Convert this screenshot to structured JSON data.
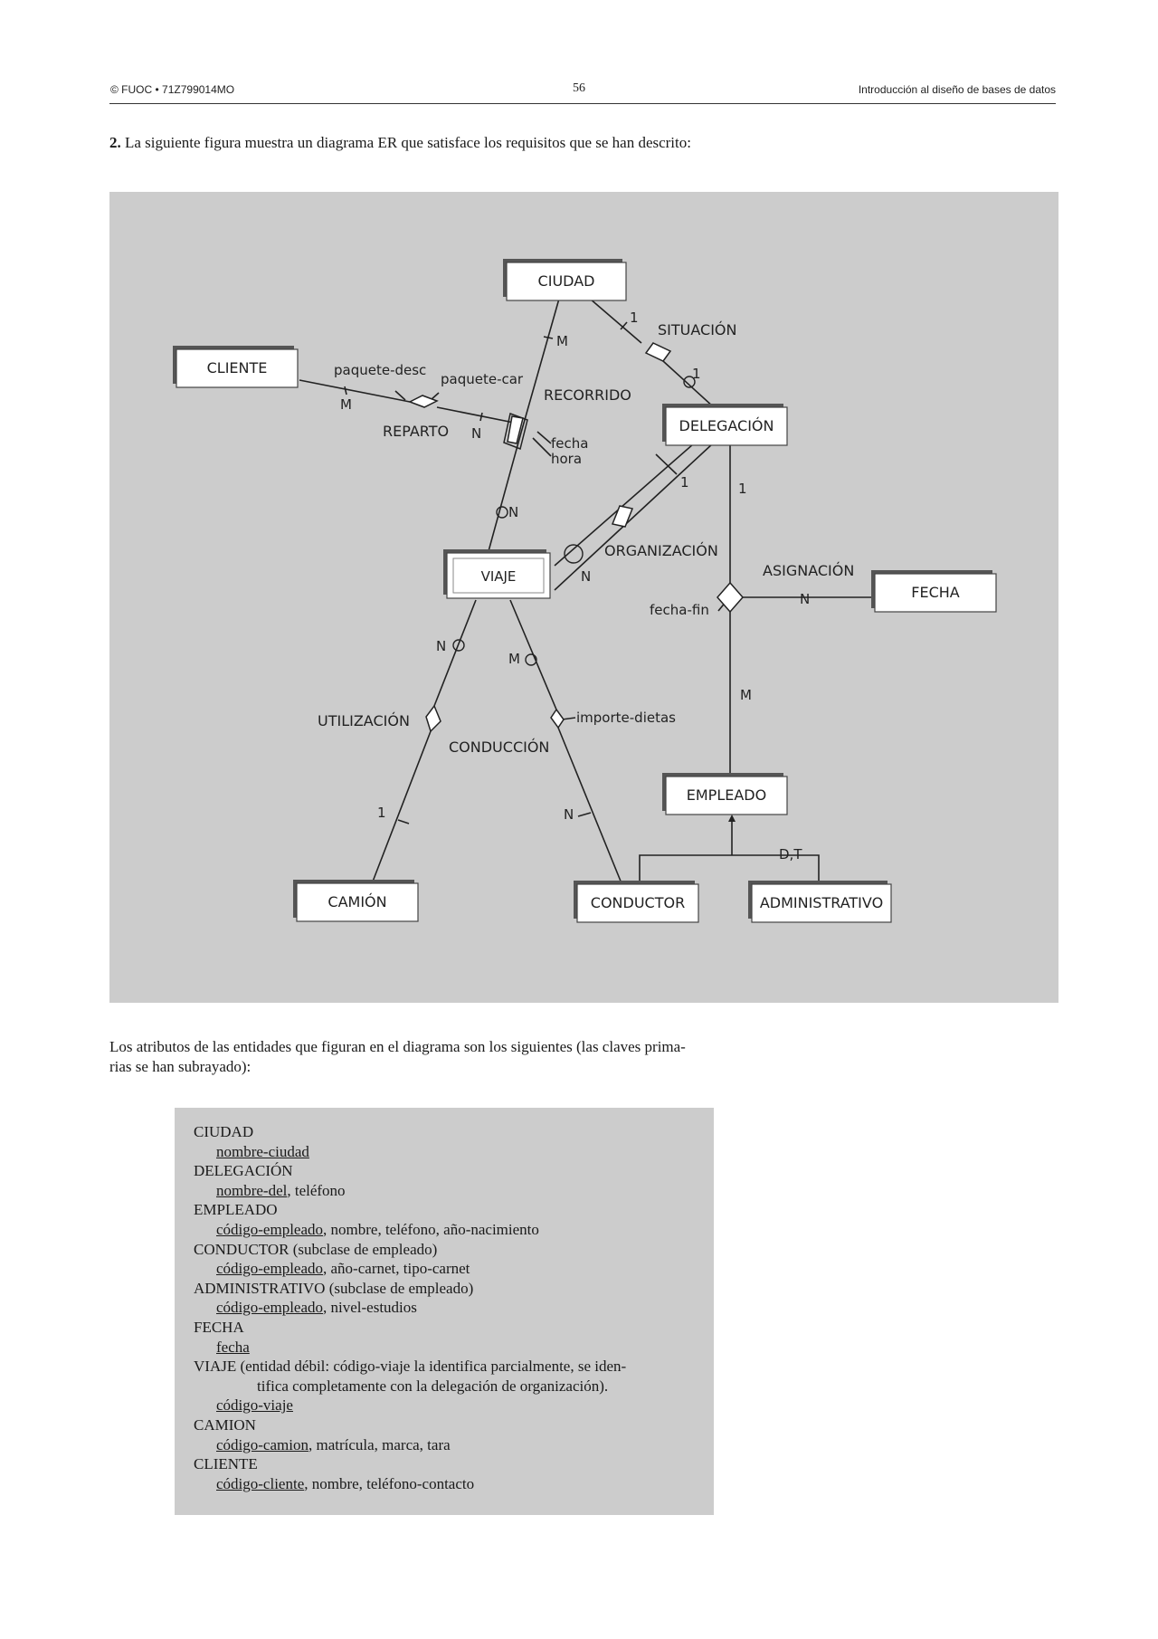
{
  "header": {
    "left": "© FUOC • 71Z799014MO",
    "page_number": "56",
    "right": "Introducción al diseño de bases de datos"
  },
  "intro": {
    "number": "2.",
    "text": "La siguiente figura muestra un diagrama ER que satisface los requisitos que se han descrito:"
  },
  "diagram": {
    "entities": {
      "ciudad": "CIUDAD",
      "cliente": "CLIENTE",
      "delegacion": "DELEGACIÓN",
      "viaje": "VIAJE",
      "fecha": "FECHA",
      "empleado": "EMPLEADO",
      "camion": "CAMIÓN",
      "conductor": "CONDUCTOR",
      "administrativo": "ADMINISTRATIVO"
    },
    "relationships": {
      "situacion": "SITUACIÓN",
      "reparto": "REPARTO",
      "recorrido": "RECORRIDO",
      "organizacion": "ORGANIZACIÓN",
      "asignacion": "ASIGNACIÓN",
      "utilizacion": "UTILIZACIÓN",
      "conduccion": "CONDUCCIÓN"
    },
    "attributes": {
      "paquete_desc": "paquete-desc",
      "paquete_car": "paquete-car",
      "fecha": "fecha",
      "hora": "hora",
      "fecha_fin": "fecha-fin",
      "importe_dietas": "importe-dietas"
    },
    "cardinalities": {
      "ciudad_recorrido": "M",
      "ciudad_situacion": "1",
      "situacion_delegacion": "1",
      "cliente_reparto": "M",
      "reparto_recorrido": "N",
      "recorrido_viaje": "N",
      "delegacion_organizacion": "1",
      "organizacion_viaje": "N",
      "delegacion_asignacion": "1",
      "asignacion_fecha": "N",
      "asignacion_empleado": "M",
      "viaje_utilizacion": "N",
      "viaje_conduccion": "M",
      "utilizacion_camion": "1",
      "conduccion_conductor": "N"
    },
    "generalization": "D,T"
  },
  "attributes_intro": {
    "line1": "Los atributos de las entidades que figuran en el diagrama son los siguientes (las claves prima-",
    "line2": "rias se han subrayado):"
  },
  "attribute_list": [
    {
      "entity": "CIUDAD",
      "key": "nombre-ciudad",
      "rest": ""
    },
    {
      "entity": "DELEGACIÓN",
      "key": "nombre-del",
      "rest": ", teléfono"
    },
    {
      "entity": "EMPLEADO",
      "key": "código-empleado",
      "rest": ", nombre, teléfono, año-nacimiento"
    },
    {
      "entity": "CONDUCTOR (subclase de empleado)",
      "key": "código-empleado",
      "rest": ", año-carnet, tipo-carnet"
    },
    {
      "entity": "ADMINISTRATIVO (subclase de empleado)",
      "key": "código-empleado",
      "rest": ", nivel-estudios"
    },
    {
      "entity": "FECHA",
      "key": "fecha",
      "rest": ""
    },
    {
      "entity": "VIAJE (entidad débil: código-viaje la identifica parcialmente, se iden-",
      "entity_cont": "tifica completamente con la delegación de organización).",
      "key": "código-viaje",
      "rest": ""
    },
    {
      "entity": "CAMION",
      "key": "código-camion",
      "rest": ", matrícula, marca, tara"
    },
    {
      "entity": "CLIENTE",
      "key": "código-cliente",
      "rest": ", nombre, teléfono-contacto"
    }
  ]
}
